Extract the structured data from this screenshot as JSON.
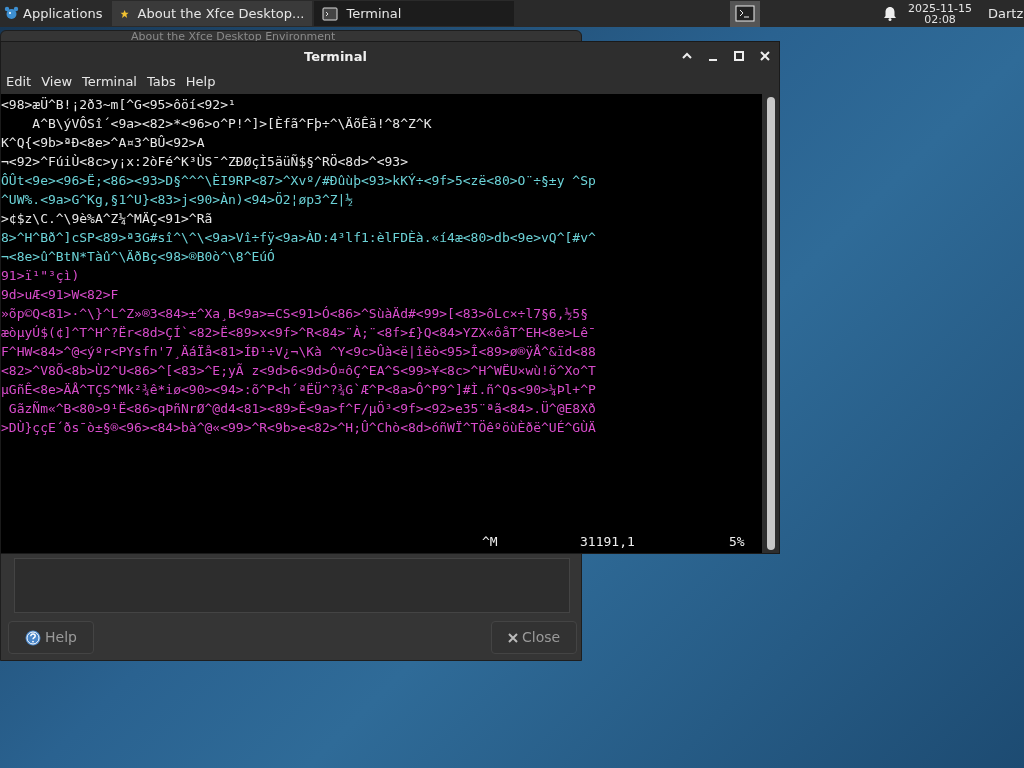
{
  "panel": {
    "applications_label": "Applications",
    "tasks": [
      {
        "label": "About the Xfce Desktop...",
        "kind": "about",
        "selected": false
      },
      {
        "label": "Terminal",
        "kind": "terminal",
        "selected": true
      }
    ],
    "clock": {
      "date": "2025-11-15",
      "time": "02:08"
    },
    "user": "Dartz"
  },
  "about_window": {
    "title": "About the Xfce Desktop Environment",
    "buttons": [
      {
        "label": "Help",
        "kind": "help"
      },
      {
        "label": "Close",
        "kind": "close"
      }
    ]
  },
  "terminal": {
    "title": "Terminal",
    "menu": [
      "Edit",
      "View",
      "Terminal",
      "Tabs",
      "Help"
    ],
    "lines": [
      {
        "text": "<98>æÜ^B!¡2ð3~m[^G<95>ôöí<92>¹",
        "color": "#e8e8e8"
      },
      {
        "text": "    A^B\\ýVÔSî´<9a><82>*<96>o^P!^]>[Èfã^Fþ÷^\\ÄõÊä!^8^Z^K",
        "color": "#e8e8e8"
      },
      {
        "text": "K^Q{<9b>ªÐ<8e>^A¤3^BÛ<92>A",
        "color": "#e8e8e8"
      },
      {
        "text": "¬<92>^FúiÙ<8c>y¡x:2òFé^K³ÙS¯^ZÐØçÌ5äüÑ$§^RÖ<8d>^<93>",
        "color": "#e8e8e8"
      },
      {
        "text": "ÔÛt<9e><96>Ë;<86><93>D§^^^\\ÈI9RP<87>^Xvº/#Ðûùþ<93>kKÝ÷<9f>5<zë<80>O¨÷§±y ^Sp",
        "color": "#6cd3d8"
      },
      {
        "text": "^UW%.<9a>G^Kg,§1^U}<83>j<90>Àn)<94>Ö2¦øp3^Z|½",
        "color": "#6cd3d8"
      },
      {
        "text": ">¢$z\\C.^\\9è%A^Z¼^MÄÇ<91>^Rã",
        "color": "#e8e8e8"
      },
      {
        "text": "8>^H^Bð^]cSP<89>ª3G#sî^\\^\\<9a>Vî÷fÿ<9a>ÀD:4³lf1:èlFDÈà.«í4æ<80>db<9e>vQ^[#v^",
        "color": "#6cd3d8"
      },
      {
        "text": "¬<8e>û^BtN*Tàû^\\ÄðBç<98>®B0ò^\\8^EúÓ",
        "color": "#6cd3d8"
      },
      {
        "text": "91>ï¹\"³çì)",
        "color": "#d84ccb"
      },
      {
        "text": "9d>uÆ<91>W<82>F",
        "color": "#d84ccb"
      },
      {
        "text": "»õp©Q<81>·^\\}^L^Z»®3<84>±^Xa¸B<9a>=CS<91>Ó<86>^SùàÄd#<99>[<83>ôLc×÷l7§6,½5§",
        "color": "#d84ccb"
      },
      {
        "text": "æòµyÚ$(¢]^T^H^?Ër<8d>ÇÍ`<82>Ë<89>x<9f>^R<84>¨À;¨<8f>£}Q<84>YZX«ôåT^EH<8e>Lê¯",
        "color": "#d84ccb"
      },
      {
        "text": "F^HW<84>^@<ýºr<PYsfn'7¸ÄáÏå<81>ÍÐ¹÷V¿¬\\Kà ^Y<9c>Ûà<ë|îëò<95>Î<89>ø®ÿÅ^&ïd<88",
        "color": "#d84ccb"
      },
      {
        "text": "<82>^V8Õ<8b>Ù2^U<86>^[<83>^E;yÃ z<9d>6<9d>Ó¤ôÇ^EA^S<99>¥<8c>^H^WËU×wù!ö^Xo^T",
        "color": "#d84ccb"
      },
      {
        "text": "µGñÊ<8e>ÄÅ^TÇS^Mk²¾ê*iø<90><94>:õ^P<h´ªËÜ^?¾G`Æ^P<8a>Ô^P9^]#Ì.ñ^Qs<90>¼Þl+^P",
        "color": "#d84ccb"
      },
      {
        "text": " GãzÑm«^B<80>9¹Ë<86>qÞñNrØ^@d4<81><89>Ê<9a>f^F/µÖ³<9f><92>e35¨ªã<84>.Ü^@E8Xð",
        "color": "#d84ccb"
      },
      {
        "text": ">DÙ}ççE´ðs¯ò±§®<96><84>bà^@«<99>^R<9b>e<82>^H;Û^Chò<8d>óñWÏ^TÖêºöùÈðë^UÉ^GÙÄ",
        "color": "#d84ccb"
      }
    ],
    "status": [
      "^M",
      "31191,1",
      "5%"
    ]
  }
}
